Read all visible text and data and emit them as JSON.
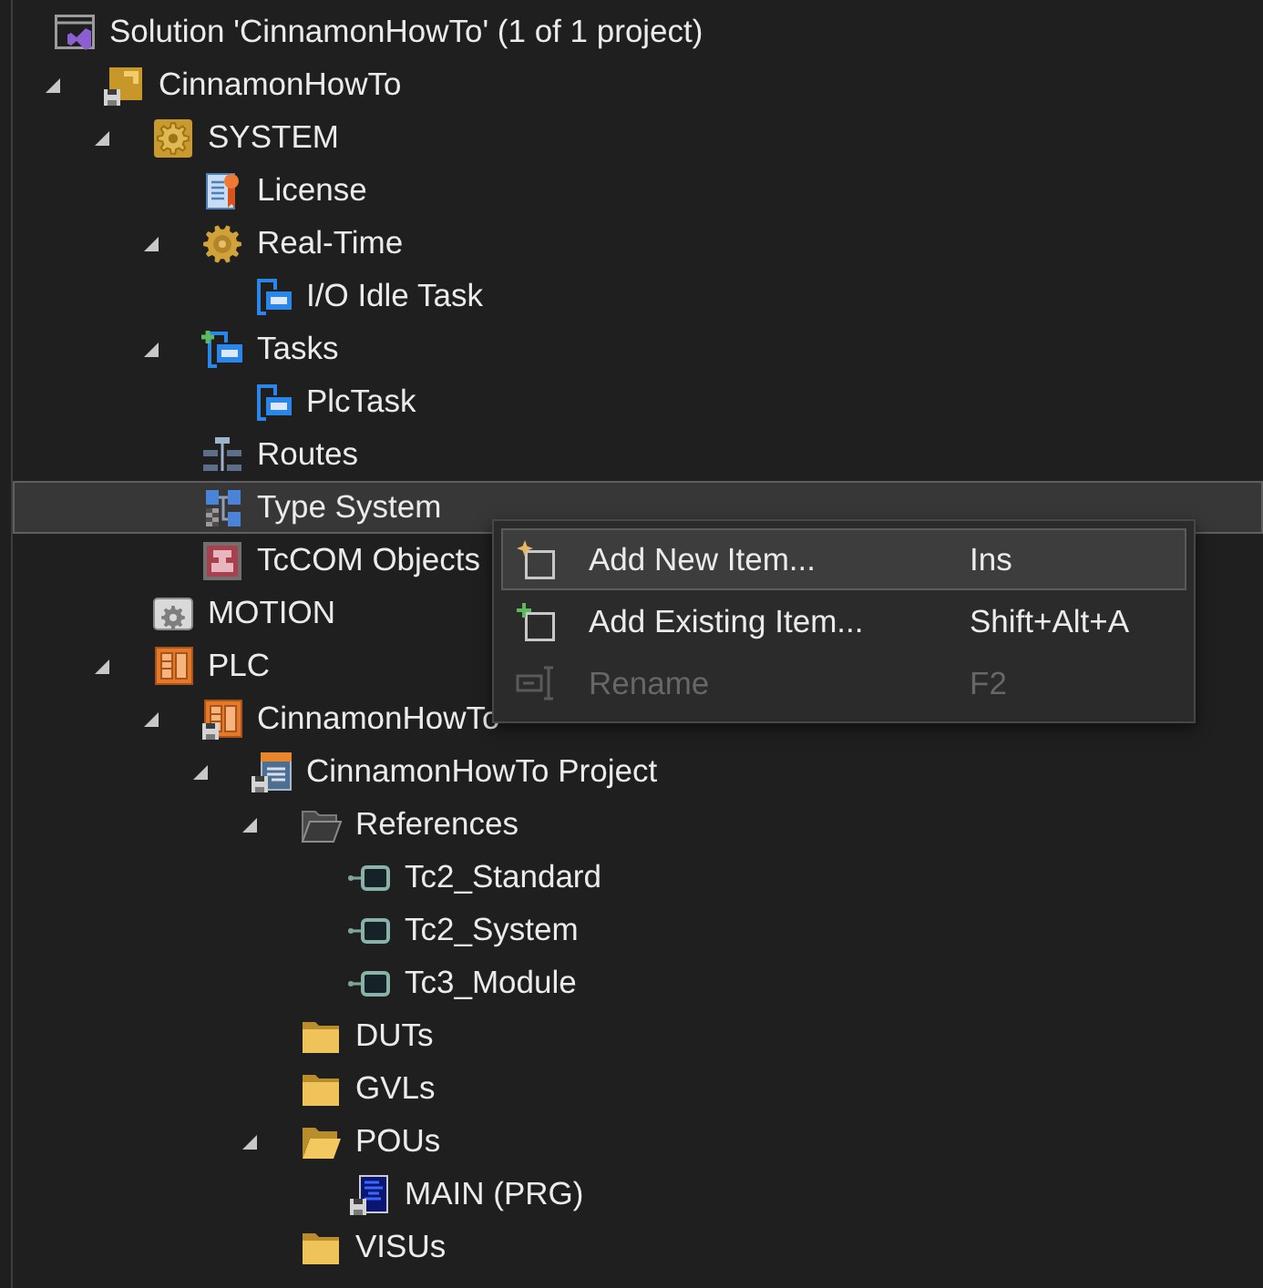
{
  "tree": [
    {
      "label": "Solution 'CinnamonHowTo' (1 of 1 project)",
      "kind": "solution",
      "selected": false,
      "children": [
        {
          "label": "CinnamonHowTo",
          "kind": "project",
          "expanded": true,
          "selected": false,
          "children": [
            {
              "label": "SYSTEM",
              "kind": "system",
              "expanded": true,
              "selected": false,
              "children": [
                {
                  "label": "License",
                  "kind": "license",
                  "selected": false
                },
                {
                  "label": "Real-Time",
                  "kind": "realtime",
                  "expanded": true,
                  "selected": false,
                  "children": [
                    {
                      "label": "I/O Idle Task",
                      "kind": "task",
                      "selected": false
                    }
                  ]
                },
                {
                  "label": "Tasks",
                  "kind": "tasks",
                  "expanded": true,
                  "selected": false,
                  "children": [
                    {
                      "label": "PlcTask",
                      "kind": "task",
                      "selected": false
                    }
                  ]
                },
                {
                  "label": "Routes",
                  "kind": "routes",
                  "selected": false
                },
                {
                  "label": "Type System",
                  "kind": "types",
                  "selected": true
                },
                {
                  "label": "TcCOM Objects",
                  "kind": "tccom",
                  "selected": false
                }
              ]
            },
            {
              "label": "MOTION",
              "kind": "motion",
              "selected": false
            },
            {
              "label": "PLC",
              "kind": "plc",
              "expanded": true,
              "selected": false,
              "children": [
                {
                  "label": "CinnamonHowTo",
                  "kind": "plc-project",
                  "expanded": true,
                  "selected": false,
                  "children": [
                    {
                      "label": "CinnamonHowTo Project",
                      "kind": "plc-file",
                      "expanded": true,
                      "selected": false,
                      "children": [
                        {
                          "label": "References",
                          "kind": "references",
                          "expanded": true,
                          "selected": false,
                          "children": [
                            {
                              "label": "Tc2_Standard",
                              "kind": "library",
                              "selected": false
                            },
                            {
                              "label": "Tc2_System",
                              "kind": "library",
                              "selected": false
                            },
                            {
                              "label": "Tc3_Module",
                              "kind": "library",
                              "selected": false
                            }
                          ]
                        },
                        {
                          "label": "DUTs",
                          "kind": "folder",
                          "selected": false
                        },
                        {
                          "label": "GVLs",
                          "kind": "folder",
                          "selected": false
                        },
                        {
                          "label": "POUs",
                          "kind": "folder",
                          "expanded": true,
                          "selected": false,
                          "children": [
                            {
                              "label": "MAIN (PRG)",
                              "kind": "program",
                              "selected": false
                            }
                          ]
                        },
                        {
                          "label": "VISUs",
                          "kind": "folder",
                          "selected": false
                        }
                      ]
                    }
                  ]
                }
              ]
            }
          ]
        }
      ]
    }
  ],
  "context_menu": {
    "items": [
      {
        "label": "Add New Item...",
        "shortcut": "Ins",
        "kind": "new",
        "selected": true,
        "disabled": false
      },
      {
        "label": "Add Existing Item...",
        "shortcut": "Shift+Alt+A",
        "kind": "existing",
        "selected": false,
        "disabled": false
      },
      {
        "label": "Rename",
        "shortcut": "F2",
        "kind": "rename",
        "selected": false,
        "disabled": true
      }
    ]
  }
}
